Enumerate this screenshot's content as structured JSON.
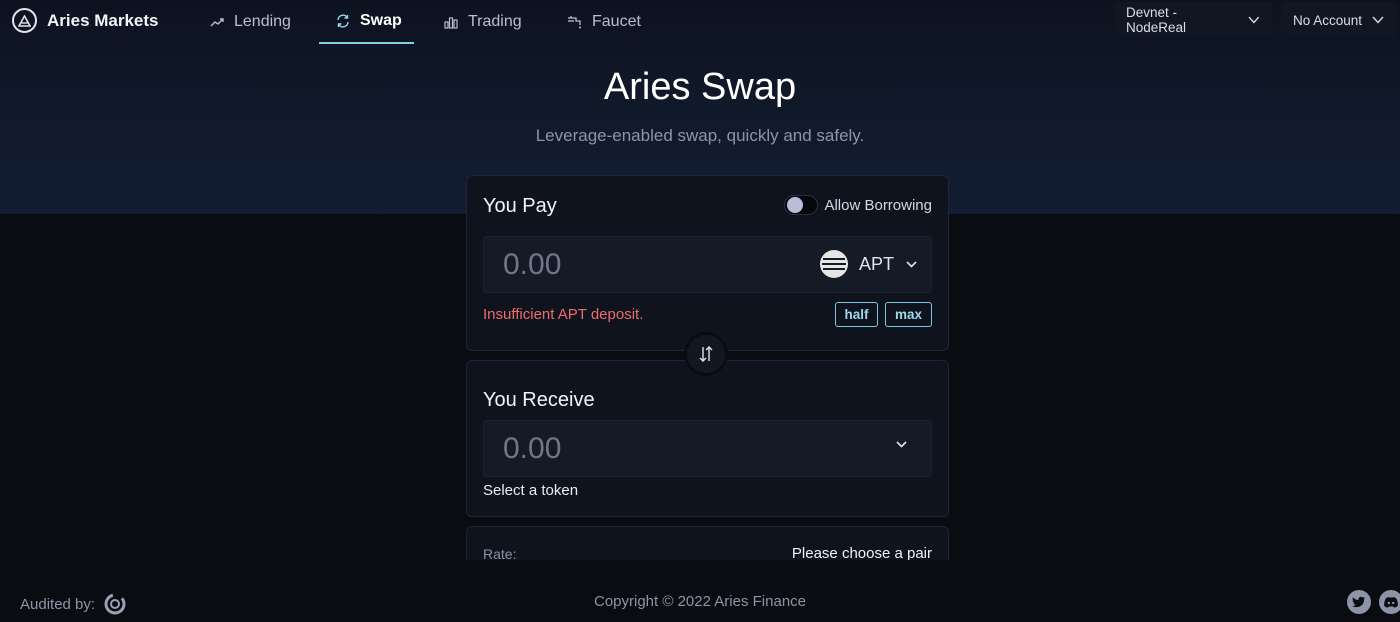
{
  "brand": {
    "name": "Aries Markets",
    "logo_icon": "aries-logo-icon"
  },
  "nav": {
    "items": [
      {
        "label": "Lending",
        "icon": "trend-up-icon"
      },
      {
        "label": "Swap",
        "icon": "refresh-icon",
        "active": true
      },
      {
        "label": "Trading",
        "icon": "bar-chart-icon"
      },
      {
        "label": "Faucet",
        "icon": "faucet-icon"
      }
    ],
    "network": "Devnet - NodeReal",
    "account": "No Account"
  },
  "hero": {
    "title": "Aries Swap",
    "subtitle": "Leverage-enabled swap, quickly and safely."
  },
  "pay": {
    "title": "You Pay",
    "allow_borrowing_label": "Allow Borrowing",
    "allow_borrowing_on": false,
    "amount_placeholder": "0.00",
    "token": "APT",
    "warning": "Insufficient APT deposit.",
    "half_label": "half",
    "max_label": "max"
  },
  "receive": {
    "title": "You Receive",
    "amount_placeholder": "0.00",
    "select_token_label": "Select a token"
  },
  "rate": {
    "label": "Rate:",
    "value": "Please choose a pair"
  },
  "footer": {
    "audited_by": "Audited by:",
    "copyright": "Copyright © 2022 Aries Finance",
    "social": [
      "twitter-icon",
      "discord-icon"
    ]
  },
  "colors": {
    "background": "#0a0c12",
    "accent": "#7fd3e0",
    "warning": "#ee6c6c",
    "card": "#0f131d"
  }
}
